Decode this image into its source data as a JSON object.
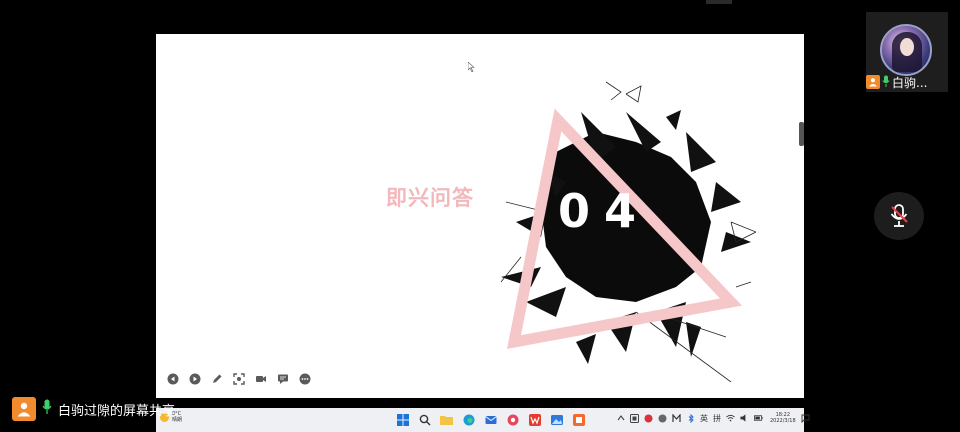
{
  "slide": {
    "title": "即兴问答",
    "section_number": "04",
    "controls": [
      "prev-icon",
      "play-icon",
      "pen-icon",
      "screenshot-icon",
      "camera-icon",
      "comment-icon",
      "more-icon"
    ]
  },
  "taskbar": {
    "weather_temp": "8°C",
    "weather_desc": "晴朗",
    "ime_lang": "英",
    "ime_mode": "拼",
    "clock_time": "18:22",
    "clock_date": "2022/3/18"
  },
  "participant": {
    "name": "白驹..."
  },
  "share": {
    "label": "白驹过隙的屏幕共享"
  },
  "colors": {
    "accent_orange": "#f28a2e",
    "mic_green": "#3fd06b",
    "slide_pink": "#f2b8bc",
    "muted_red": "#e0454a"
  }
}
